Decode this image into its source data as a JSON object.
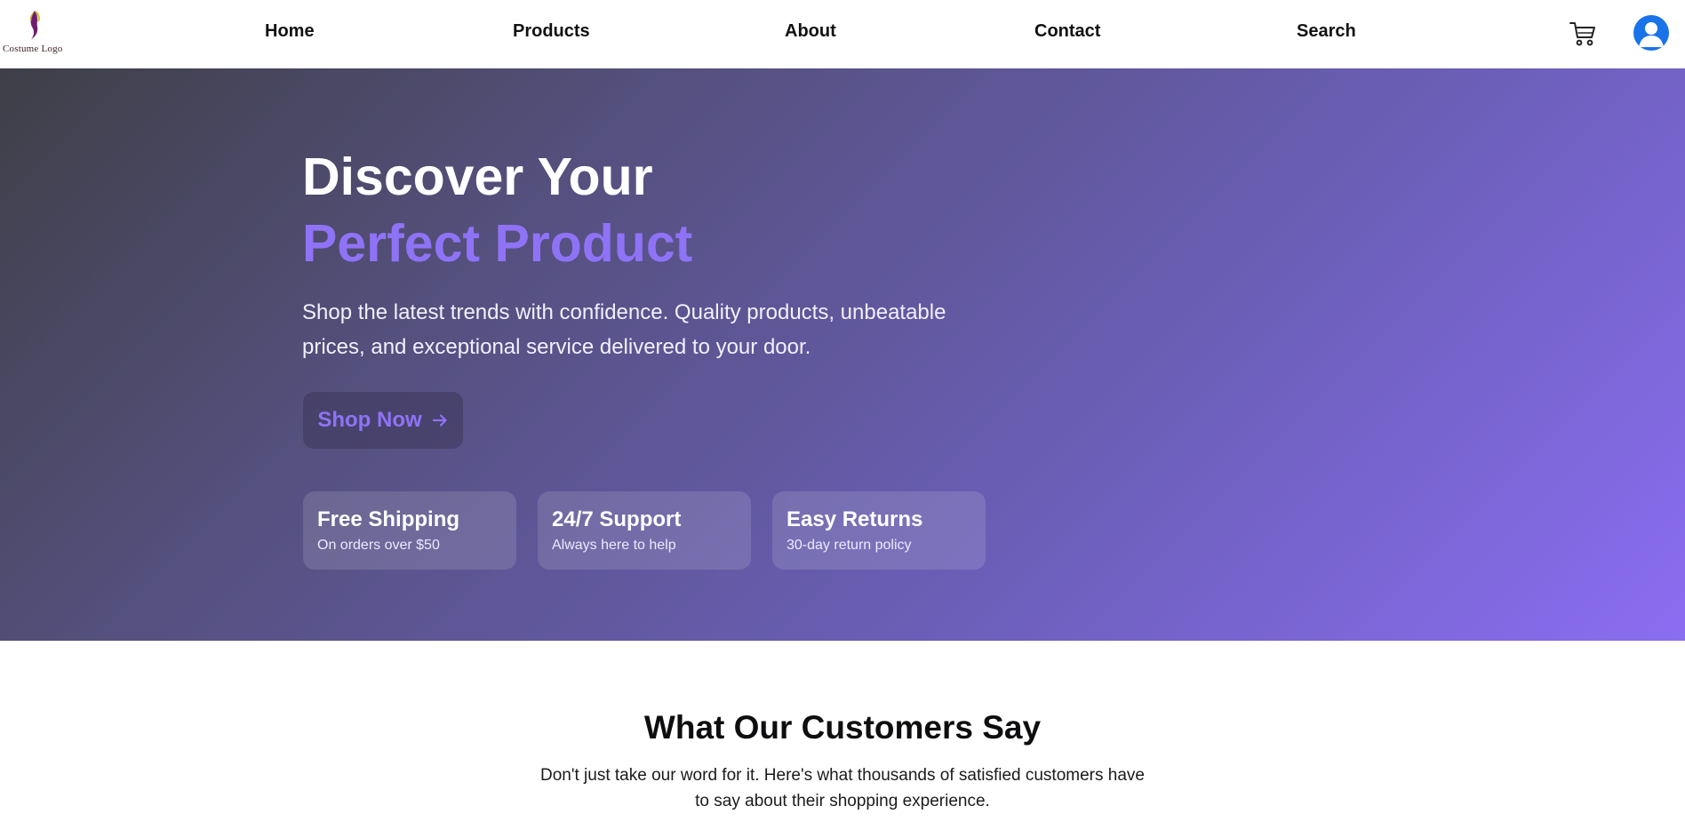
{
  "brand": {
    "logo_text": "Costume Logo"
  },
  "nav": {
    "links": [
      "Home",
      "Products",
      "About",
      "Contact",
      "Search"
    ]
  },
  "icons": {
    "cart": "cart-icon",
    "profile": "user-avatar-icon",
    "arrow": "arrow-right-icon"
  },
  "hero": {
    "title_line1": "Discover Your",
    "title_line2": "Perfect Product",
    "subtitle": "Shop the latest trends with confidence. Quality products, unbeatable prices, and exceptional service delivered to your door.",
    "cta_label": "Shop Now",
    "features": [
      {
        "title": "Free Shipping",
        "desc": "On orders over $50"
      },
      {
        "title": "24/7 Support",
        "desc": "Always here to help"
      },
      {
        "title": "Easy Returns",
        "desc": "30-day return policy"
      }
    ]
  },
  "testimonials": {
    "title": "What Our Customers Say",
    "subtitle": "Don't just take our word for it. Here's what thousands of satisfied customers have to say about their shopping experience."
  },
  "colors": {
    "accent": "#8f73f6",
    "avatar_bg": "#1a73e8",
    "hero_gradient_start": "#3e3f47",
    "hero_gradient_end": "#8b6df2"
  }
}
